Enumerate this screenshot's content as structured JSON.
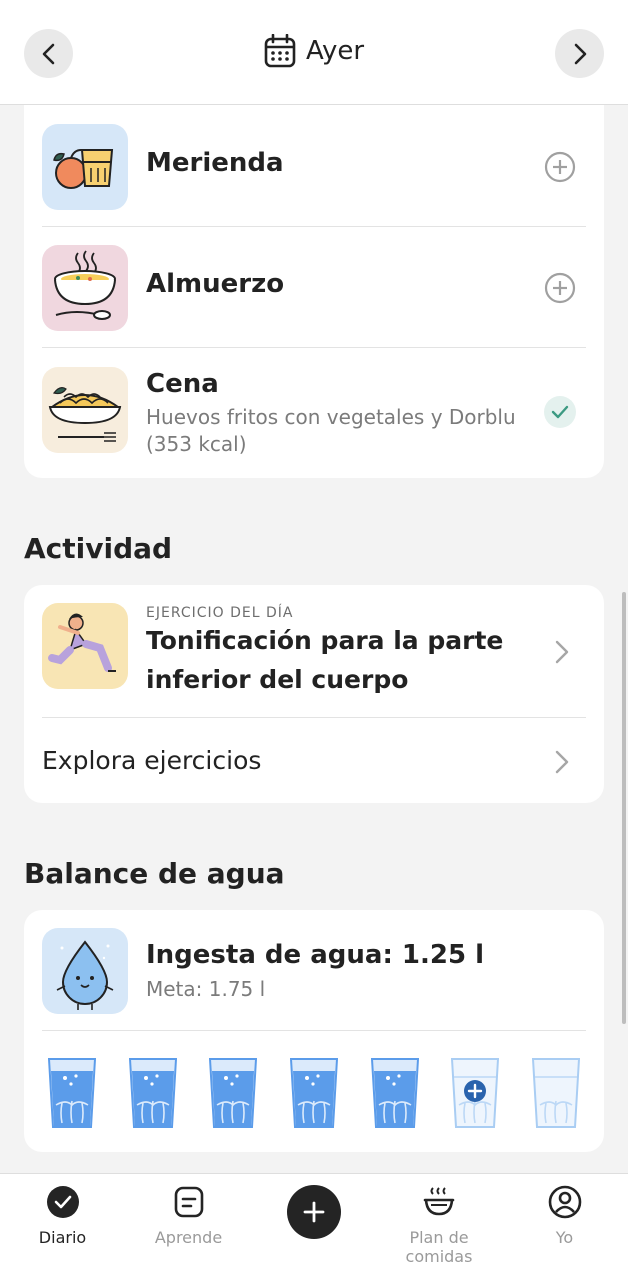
{
  "header": {
    "title": "Ayer",
    "prev_icon": "chevron-left-icon",
    "next_icon": "chevron-right-icon",
    "calendar_icon": "calendar-icon"
  },
  "meals": [
    {
      "name": "Merienda",
      "status": "add",
      "thumb": "snack-illustration"
    },
    {
      "name": "Almuerzo",
      "status": "add",
      "thumb": "soup-illustration"
    },
    {
      "name": "Cena",
      "status": "done",
      "description": "Huevos fritos con vegetales y Dorblu (353 kcal)",
      "thumb": "pasta-illustration"
    }
  ],
  "activity": {
    "section_title": "Actividad",
    "eyebrow": "EJERCICIO DEL DÍA",
    "workout_title": "Tonificación para la parte inferior del cuerpo",
    "explore_label": "Explora ejercicios"
  },
  "water": {
    "section_title": "Balance de agua",
    "intake_label": "Ingesta de agua: 1.25 l",
    "goal_label": "Meta: 1.75 l",
    "glasses_total": 7,
    "glasses_filled": 5,
    "accent": "#5b9cea"
  },
  "bottom_nav": {
    "items": [
      {
        "label": "Diario",
        "icon": "check-circle-icon",
        "active": true
      },
      {
        "label": "Aprende",
        "icon": "article-icon",
        "active": false
      },
      {
        "label": "",
        "icon": "plus-icon",
        "active": false
      },
      {
        "label": "Plan de comidas",
        "icon": "bowl-icon",
        "active": false
      },
      {
        "label": "Yo",
        "icon": "profile-icon",
        "active": false
      }
    ]
  }
}
